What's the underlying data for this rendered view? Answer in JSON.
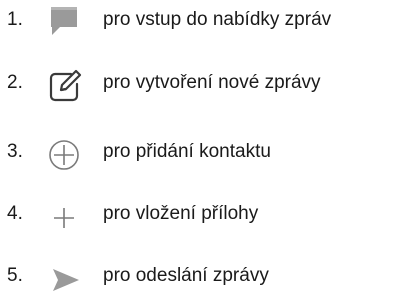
{
  "steps": [
    {
      "number": "1.",
      "icon": "message-bubble-icon",
      "text": "pro vstup do nabídky zpráv"
    },
    {
      "number": "2.",
      "icon": "compose-icon",
      "text": "pro vytvoření nové zprávy"
    },
    {
      "number": "3.",
      "icon": "add-contact-icon",
      "text": "pro přidání kontaktu"
    },
    {
      "number": "4.",
      "icon": "plus-icon",
      "text": "pro vložení přílohy"
    },
    {
      "number": "5.",
      "icon": "send-icon",
      "text": "pro odeslání zprávy"
    }
  ],
  "colors": {
    "text": "#1a1a1a",
    "icon_gray": "#9a9a9a",
    "icon_dark": "#3a3a3a"
  }
}
